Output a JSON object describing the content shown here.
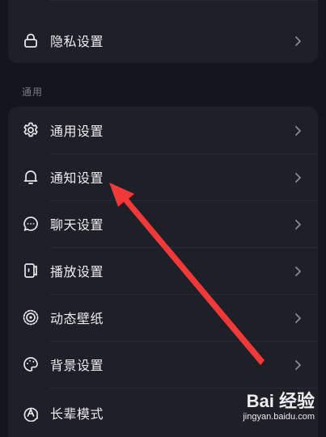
{
  "privacy_card": {
    "items": [
      {
        "label": "隐私设置",
        "icon": "lock-icon"
      }
    ]
  },
  "general_section": {
    "title": "通用",
    "items": [
      {
        "label": "通用设置",
        "icon": "gear-icon"
      },
      {
        "label": "通知设置",
        "icon": "bell-icon"
      },
      {
        "label": "聊天设置",
        "icon": "chat-bubble-icon"
      },
      {
        "label": "播放设置",
        "icon": "play-device-icon"
      },
      {
        "label": "动态壁纸",
        "icon": "live-wallpaper-icon"
      },
      {
        "label": "背景设置",
        "icon": "palette-icon"
      },
      {
        "label": "长辈模式",
        "icon": "elder-mode-icon"
      }
    ]
  },
  "colors": {
    "background": "#15151d",
    "card": "#1f1f28",
    "annotation_arrow": "#f03a3a"
  },
  "watermark": {
    "brand_text": "Bai 经验",
    "url": "jingyan.baidu.com"
  }
}
